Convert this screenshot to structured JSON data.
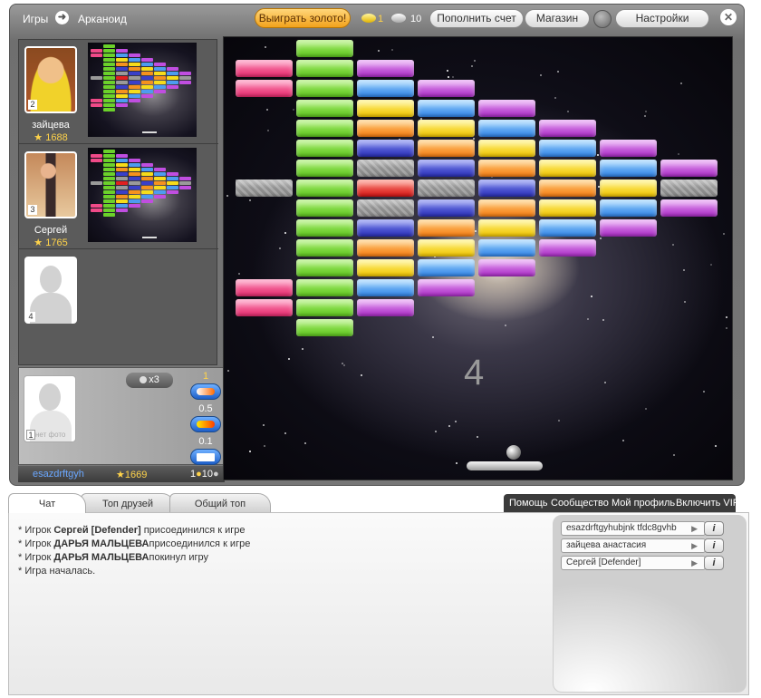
{
  "topbar": {
    "games": "Игры",
    "game_name": "Арканоид",
    "win_gold": "Выиграть золото!",
    "gold_count": "1",
    "silver_count": "10",
    "refill": "Пополнить счет",
    "shop": "Магазин",
    "settings": "Настройки"
  },
  "players": [
    {
      "name": "зайцева",
      "score": "1688",
      "slot": "2"
    },
    {
      "name": "Сергей",
      "score": "1765",
      "slot": "3"
    },
    {
      "slot": "4"
    }
  ],
  "own": {
    "slot": "1",
    "no_photo": "нет фото",
    "balls": "x3",
    "power_1_cost": "1",
    "power_2_cost": "0.5",
    "power_3_cost": "0.1",
    "username": "esazdrftgyh",
    "score": "1669",
    "coins": "1",
    "silver": "10"
  },
  "field": {
    "countdown": "4"
  },
  "bricks": [
    {
      "row": 0,
      "col": 1,
      "color": "green"
    },
    {
      "row": 1,
      "col": 0,
      "color": "pink"
    },
    {
      "row": 1,
      "col": 1,
      "color": "green"
    },
    {
      "row": 1,
      "col": 2,
      "color": "purple"
    },
    {
      "row": 2,
      "col": 0,
      "color": "pink"
    },
    {
      "row": 2,
      "col": 1,
      "color": "green"
    },
    {
      "row": 2,
      "col": 2,
      "color": "blue"
    },
    {
      "row": 2,
      "col": 3,
      "color": "purple"
    },
    {
      "row": 3,
      "col": 1,
      "color": "green"
    },
    {
      "row": 3,
      "col": 2,
      "color": "yellow"
    },
    {
      "row": 3,
      "col": 3,
      "color": "blue"
    },
    {
      "row": 3,
      "col": 4,
      "color": "purple"
    },
    {
      "row": 4,
      "col": 1,
      "color": "green"
    },
    {
      "row": 4,
      "col": 2,
      "color": "orange"
    },
    {
      "row": 4,
      "col": 3,
      "color": "yellow"
    },
    {
      "row": 4,
      "col": 4,
      "color": "blue"
    },
    {
      "row": 4,
      "col": 5,
      "color": "purple"
    },
    {
      "row": 5,
      "col": 1,
      "color": "green"
    },
    {
      "row": 5,
      "col": 2,
      "color": "navy"
    },
    {
      "row": 5,
      "col": 3,
      "color": "orange"
    },
    {
      "row": 5,
      "col": 4,
      "color": "yellow"
    },
    {
      "row": 5,
      "col": 5,
      "color": "blue"
    },
    {
      "row": 5,
      "col": 6,
      "color": "purple"
    },
    {
      "row": 6,
      "col": 1,
      "color": "green"
    },
    {
      "row": 6,
      "col": 2,
      "color": "gray"
    },
    {
      "row": 6,
      "col": 3,
      "color": "navy"
    },
    {
      "row": 6,
      "col": 4,
      "color": "orange"
    },
    {
      "row": 6,
      "col": 5,
      "color": "yellow"
    },
    {
      "row": 6,
      "col": 6,
      "color": "blue"
    },
    {
      "row": 6,
      "col": 7,
      "color": "purple"
    },
    {
      "row": 7,
      "col": 0,
      "color": "gray"
    },
    {
      "row": 7,
      "col": 1,
      "color": "green"
    },
    {
      "row": 7,
      "col": 2,
      "color": "red"
    },
    {
      "row": 7,
      "col": 3,
      "color": "gray"
    },
    {
      "row": 7,
      "col": 4,
      "color": "navy"
    },
    {
      "row": 7,
      "col": 5,
      "color": "orange"
    },
    {
      "row": 7,
      "col": 6,
      "color": "yellow"
    },
    {
      "row": 7,
      "col": 7,
      "color": "gray"
    },
    {
      "row": 8,
      "col": 1,
      "color": "green"
    },
    {
      "row": 8,
      "col": 2,
      "color": "gray"
    },
    {
      "row": 8,
      "col": 3,
      "color": "navy"
    },
    {
      "row": 8,
      "col": 4,
      "color": "orange"
    },
    {
      "row": 8,
      "col": 5,
      "color": "yellow"
    },
    {
      "row": 8,
      "col": 6,
      "color": "blue"
    },
    {
      "row": 8,
      "col": 7,
      "color": "purple"
    },
    {
      "row": 9,
      "col": 1,
      "color": "green"
    },
    {
      "row": 9,
      "col": 2,
      "color": "navy"
    },
    {
      "row": 9,
      "col": 3,
      "color": "orange"
    },
    {
      "row": 9,
      "col": 4,
      "color": "yellow"
    },
    {
      "row": 9,
      "col": 5,
      "color": "blue"
    },
    {
      "row": 9,
      "col": 6,
      "color": "purple"
    },
    {
      "row": 10,
      "col": 1,
      "color": "green"
    },
    {
      "row": 10,
      "col": 2,
      "color": "orange"
    },
    {
      "row": 10,
      "col": 3,
      "color": "yellow"
    },
    {
      "row": 10,
      "col": 4,
      "color": "blue"
    },
    {
      "row": 10,
      "col": 5,
      "color": "purple"
    },
    {
      "row": 11,
      "col": 1,
      "color": "green"
    },
    {
      "row": 11,
      "col": 2,
      "color": "yellow"
    },
    {
      "row": 11,
      "col": 3,
      "color": "blue"
    },
    {
      "row": 11,
      "col": 4,
      "color": "purple"
    },
    {
      "row": 12,
      "col": 0,
      "color": "pink"
    },
    {
      "row": 12,
      "col": 1,
      "color": "green"
    },
    {
      "row": 12,
      "col": 2,
      "color": "blue"
    },
    {
      "row": 12,
      "col": 3,
      "color": "purple"
    },
    {
      "row": 13,
      "col": 0,
      "color": "pink"
    },
    {
      "row": 13,
      "col": 1,
      "color": "green"
    },
    {
      "row": 13,
      "col": 2,
      "color": "purple"
    },
    {
      "row": 14,
      "col": 1,
      "color": "green"
    }
  ],
  "tabs": [
    "Чат",
    "Топ друзей",
    "Общий топ"
  ],
  "links": [
    "Помощь",
    "Сообщество",
    "Мой профиль",
    "Включить VIP"
  ],
  "chat": [
    {
      "prefix": "* Игрок ",
      "name": "Сергей [Defender]",
      "suffix": " присоединился к игре"
    },
    {
      "prefix": "* Игрок ",
      "name": "ДАРЬЯ МАЛЬЦЕВА",
      "suffix": "присоединился к игре"
    },
    {
      "prefix": "* Игрок ",
      "name": "ДАРЬЯ МАЛЬЦЕВА",
      "suffix": "покинул игру"
    },
    {
      "prefix": "* Игра началась.",
      "name": "",
      "suffix": ""
    }
  ],
  "users": [
    "esazdrftgyhubjnk tfdc8gvhb",
    "зайцева анастасия",
    "Сергей [Defender]"
  ],
  "info_label": "i"
}
